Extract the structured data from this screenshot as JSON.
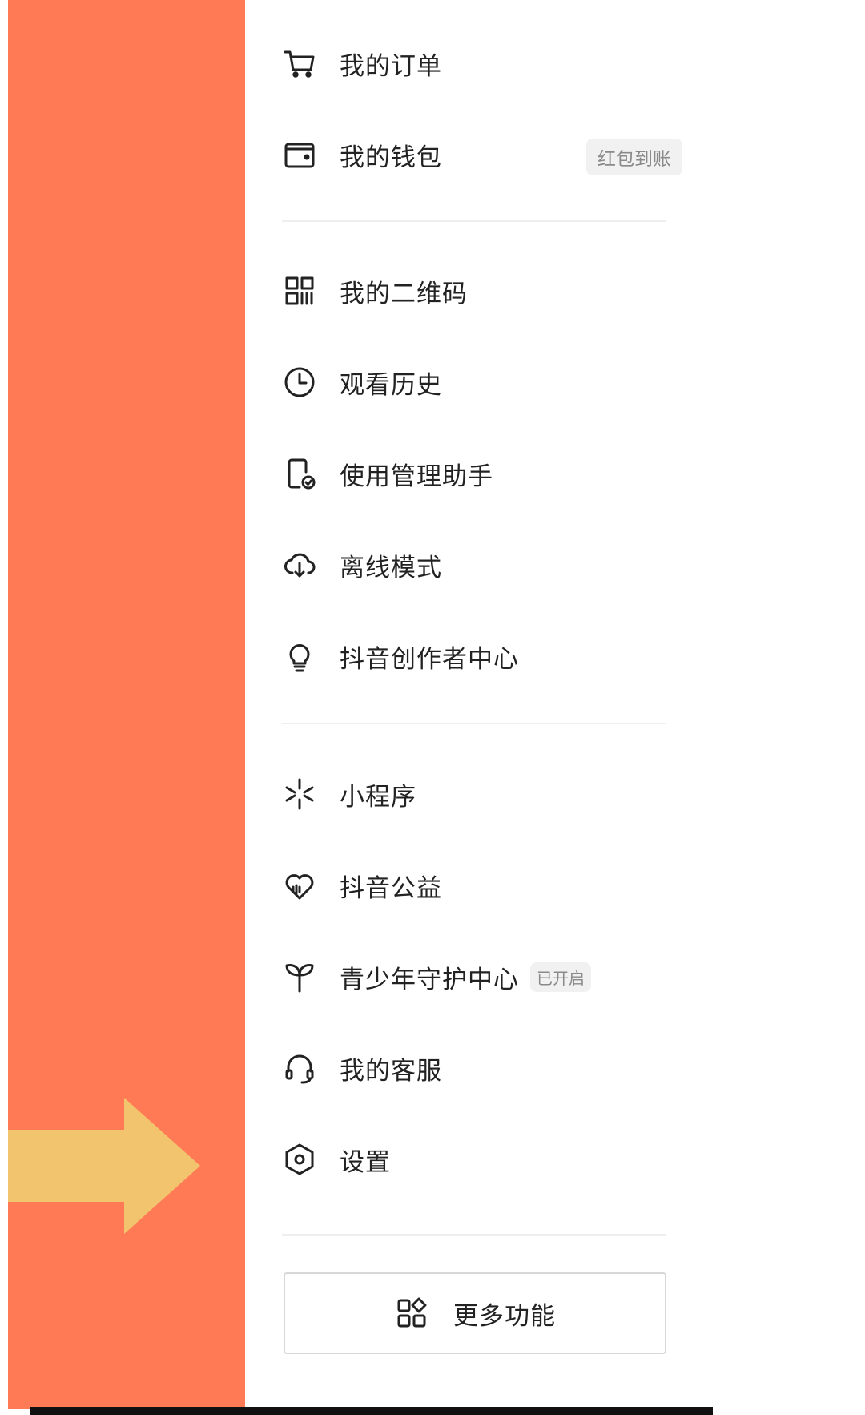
{
  "menu": {
    "group1": [
      {
        "label": "我的订单",
        "icon": "cart-icon"
      },
      {
        "label": "我的钱包",
        "icon": "wallet-icon",
        "badge": "红包到账"
      }
    ],
    "group2": [
      {
        "label": "我的二维码",
        "icon": "qr-code-icon"
      },
      {
        "label": "观看历史",
        "icon": "clock-icon"
      },
      {
        "label": "使用管理助手",
        "icon": "phone-check-icon"
      },
      {
        "label": "离线模式",
        "icon": "cloud-download-icon"
      },
      {
        "label": "抖音创作者中心",
        "icon": "lightbulb-icon"
      }
    ],
    "group3": [
      {
        "label": "小程序",
        "icon": "spark-icon"
      },
      {
        "label": "抖音公益",
        "icon": "heart-icon"
      },
      {
        "label": "青少年守护中心",
        "icon": "sprout-icon",
        "badge": "已开启"
      },
      {
        "label": "我的客服",
        "icon": "headset-icon"
      },
      {
        "label": "设置",
        "icon": "settings-hexagon-icon"
      }
    ]
  },
  "more_button": {
    "label": "更多功能",
    "icon": "grid-apps-icon"
  },
  "colors": {
    "left_panel": "#FF7A55",
    "arrow": "#F2C46E",
    "text": "#222222",
    "badge_bg": "#F1F1F1",
    "badge_text": "#8A8A8A"
  }
}
